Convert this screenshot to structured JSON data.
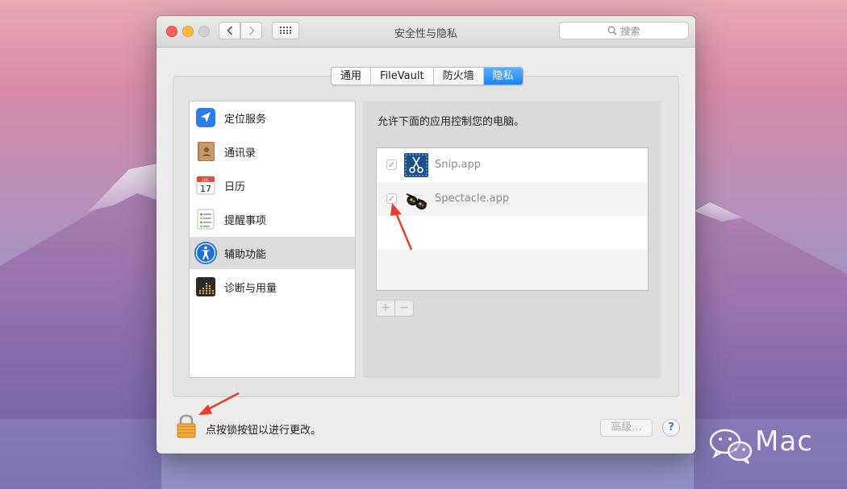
{
  "window": {
    "title": "安全性与隐私",
    "search_placeholder": "搜索"
  },
  "tabs": [
    {
      "label": "通用",
      "active": false
    },
    {
      "label": "FileVault",
      "active": false
    },
    {
      "label": "防火墙",
      "active": false
    },
    {
      "label": "隐私",
      "active": true
    }
  ],
  "sidebar": {
    "items": [
      {
        "label": "定位服务",
        "icon": "location-arrow-icon",
        "selected": false
      },
      {
        "label": "通讯录",
        "icon": "contacts-book-icon",
        "selected": false
      },
      {
        "label": "日历",
        "icon": "calendar-icon",
        "selected": false
      },
      {
        "label": "提醒事项",
        "icon": "reminders-icon",
        "selected": false
      },
      {
        "label": "辅助功能",
        "icon": "accessibility-icon",
        "selected": true
      },
      {
        "label": "诊断与用量",
        "icon": "diagnostics-icon",
        "selected": false
      }
    ],
    "calendar_icon": {
      "month": "JUL",
      "day": "17"
    }
  },
  "privacy": {
    "description": "允许下面的应用控制您的电脑。",
    "apps": [
      {
        "name": "Snip.app",
        "checked": true,
        "icon": "snip-scissors-icon"
      },
      {
        "name": "Spectacle.app",
        "checked": true,
        "icon": "spectacle-glasses-icon"
      }
    ],
    "add_label": "+",
    "remove_label": "−"
  },
  "footer": {
    "lock_text": "点按锁按钮以进行更改。",
    "advanced_label": "高级...",
    "help_label": "?"
  },
  "watermark": {
    "text": "Mac"
  },
  "colors": {
    "accent": "#1e84f4",
    "annotation_arrow": "#e83e2c"
  }
}
